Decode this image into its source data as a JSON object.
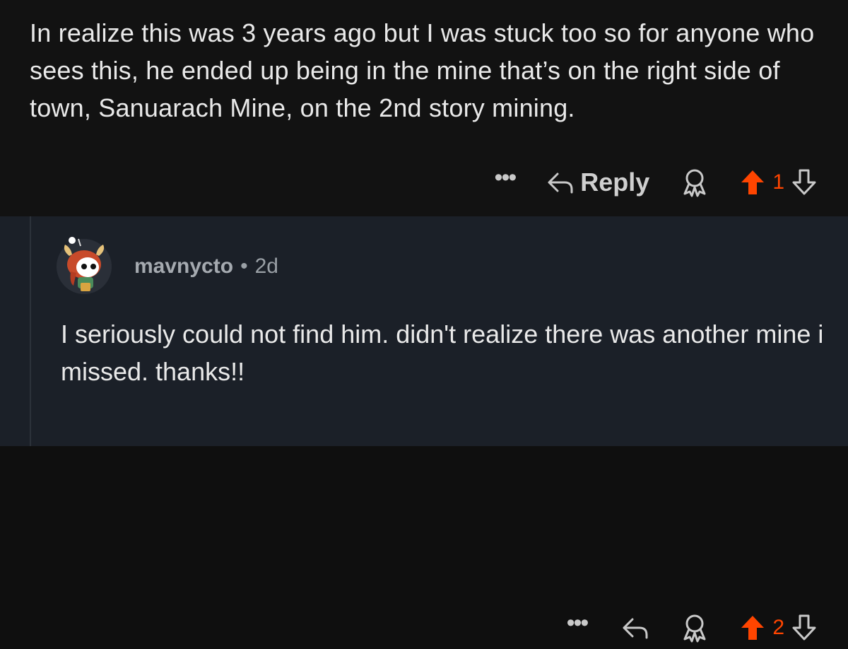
{
  "parent_comment": {
    "body": "In realize this was 3 years ago but I was stuck too so for anyone who sees this, he ended up being in the mine that’s on the right side of town, Sanuarach Mine, on the 2nd story mining.",
    "actions": {
      "more_label": "•••",
      "reply_label": "Reply",
      "vote_count": "1"
    }
  },
  "reply_comment": {
    "username": "mavnycto",
    "separator": "•",
    "age": "2d",
    "body": "I seriously could not find him. didn't realize there was another mine i missed. thanks!!",
    "actions": {
      "more_label": "•••",
      "vote_count": "2"
    }
  },
  "colors": {
    "upvote_active": "#ff4500",
    "top_background": "#121212",
    "reply_background": "#1b2028"
  }
}
